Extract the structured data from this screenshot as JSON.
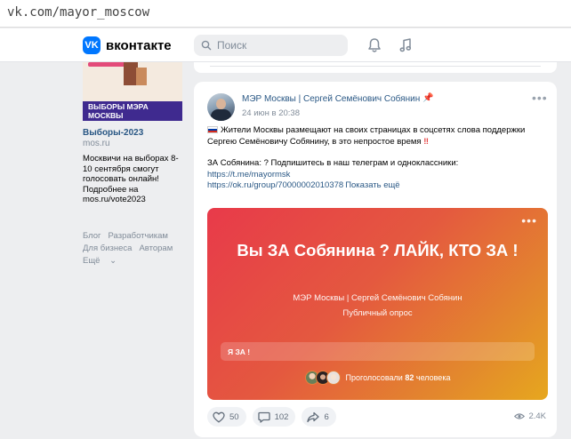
{
  "browser": {
    "url": "vk.com/mayor_moscow"
  },
  "header": {
    "logo_text": "вконтакте",
    "search_placeholder": "Поиск"
  },
  "left": {
    "promo_band": "ВЫБОРЫ МЭРА МОСКВЫ",
    "title": "Выборы-2023",
    "domain": "mos.ru",
    "text": "Москвичи на выборах 8-10 сентября смогут голосовать онлайн! Подробнее на mos.ru/vote2023",
    "links": [
      "Блог",
      "Разработчикам",
      "Для бизнеса",
      "Авторам",
      "Ещё"
    ]
  },
  "post": {
    "author": "МЭР Москвы | Сергей Семёнович Собянин",
    "date": "24 июн в 20:38",
    "text_1": "Жители Москвы размещают на своих страницах в соцсетях слова поддержки Сергею Семёновичу Собянину, в это непростое время",
    "text_2": "ЗА Собянина: ? Подпишитесь в наш телеграм и одноклассники:",
    "link_1": "https://t.me/mayormsk",
    "link_2": "https://ok.ru/group/70000002010378",
    "show_more": "Показать ещё",
    "poll": {
      "question": "Вы ЗА Собянина ? ЛАЙК, КТО ЗА !",
      "owner": "МЭР Москвы | Сергей Семёнович Собянин",
      "type": "Публичный опрос",
      "option": "Я ЗА !",
      "voted_label": "Проголосовали",
      "voted_count": "82",
      "voted_unit": "человека"
    },
    "likes": "50",
    "comments": "102",
    "shares": "6",
    "views": "2.4K"
  }
}
